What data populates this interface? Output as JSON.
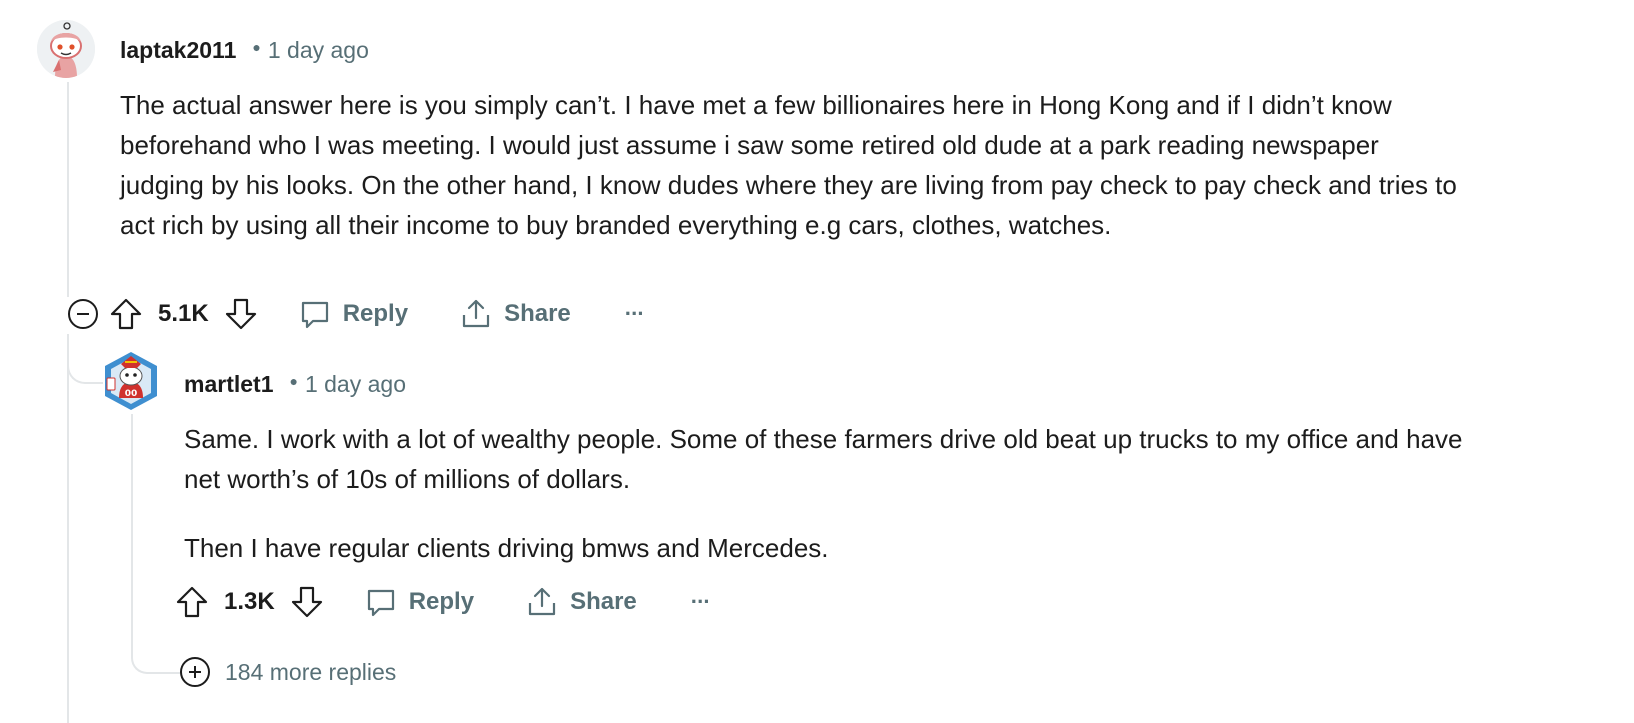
{
  "comments": [
    {
      "author": "laptak2011",
      "time": "1 day ago",
      "body": [
        "The actual answer here is you simply can’t. I have met a few billionaires here in Hong Kong and if I didn’t know beforehand who I was meeting. I would just assume i saw some retired old dude at a park reading newspaper judging by his looks. On the other hand, I know dudes where they are living from pay check to pay check and tries to act rich by using all their income to buy branded everything e.g cars, clothes, watches."
      ],
      "score": "5.1K",
      "reply_label": "Reply",
      "share_label": "Share",
      "overflow_label": "···"
    },
    {
      "author": "martlet1",
      "time": "1 day ago",
      "body": [
        "Same. I work with a lot of wealthy people. Some of these farmers drive old beat up trucks to my office and have net worth’s of 10s of millions of dollars.",
        "Then I have regular clients driving bmws and Mercedes."
      ],
      "score": "1.3K",
      "reply_label": "Reply",
      "share_label": "Share",
      "overflow_label": "···"
    }
  ],
  "more_replies": "184 more replies",
  "icons": {
    "collapse": "minus-circle-icon",
    "upvote": "arrow-up-icon",
    "downvote": "arrow-down-icon",
    "reply": "speech-bubble-icon",
    "share": "share-icon",
    "expand": "plus-circle-icon"
  },
  "colors": {
    "text": "#1c1c1c",
    "meta": "#576f76",
    "thread_line": "#e3e6e8"
  }
}
